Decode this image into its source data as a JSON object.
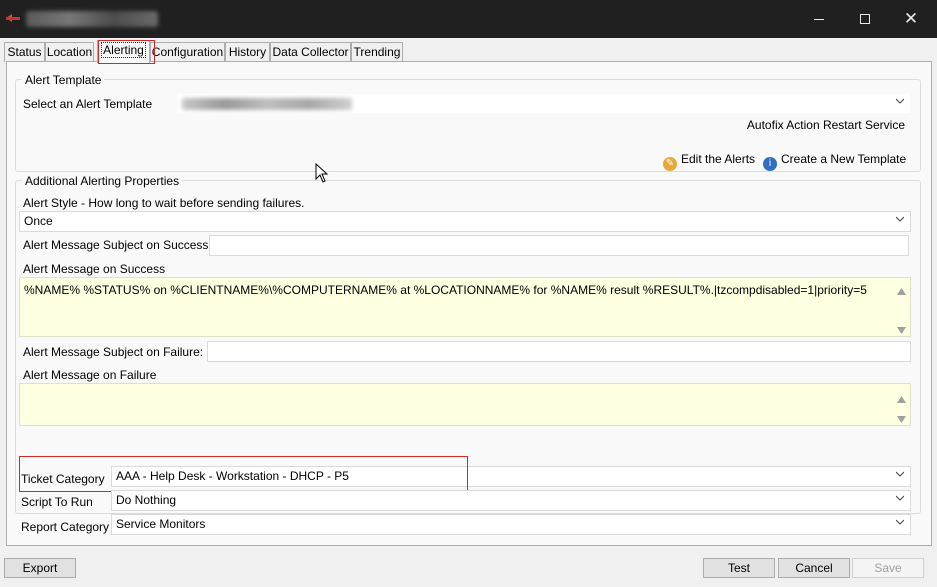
{
  "tabs": [
    {
      "label": "Status"
    },
    {
      "label": "Location"
    },
    {
      "label": "Alerting"
    },
    {
      "label": "Configuration"
    },
    {
      "label": "History"
    },
    {
      "label": "Data Collector"
    },
    {
      "label": "Trending"
    }
  ],
  "alert_template": {
    "group_title": "Alert Template",
    "select_label": "Select an Alert Template",
    "autofix_text": "Autofix Action Restart Service",
    "edit_alerts_link": "Edit the Alerts",
    "create_template_link": "Create a New Template"
  },
  "additional": {
    "group_title": "Additional Alerting Properties",
    "alert_style_label": "Alert Style - How long to wait before sending failures.",
    "alert_style_value": "Once",
    "subject_success_label": "Alert Message Subject on Success:",
    "subject_success_value": "",
    "message_success_label": "Alert Message on Success",
    "message_success_value": "%NAME% %STATUS% on %CLIENTNAME%\\%COMPUTERNAME% at %LOCATIONNAME% for %NAME% result %RESULT%.|tzcompdisabled=1|priority=5",
    "subject_failure_label": "Alert Message Subject on Failure:",
    "subject_failure_value": "",
    "message_failure_label": "Alert Message on Failure",
    "message_failure_value": ""
  },
  "ticket_category": {
    "label": "Ticket Category",
    "value": "AAA - Help Desk - Workstation - DHCP - P5"
  },
  "script_to_run": {
    "label": "Script To Run",
    "value": "Do Nothing"
  },
  "report_category": {
    "label": "Report Category",
    "value": "Service Monitors"
  },
  "buttons": {
    "export": "Export",
    "test": "Test",
    "cancel": "Cancel",
    "save": "Save"
  },
  "colors": {
    "highlight": "#d4272b",
    "textarea_bg": "#ffffe1",
    "titlebar": "#202020"
  }
}
